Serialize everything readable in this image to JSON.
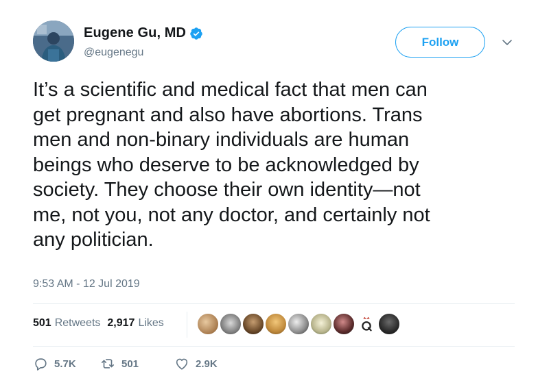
{
  "author": {
    "display_name": "Eugene Gu, MD",
    "handle": "@eugenegu",
    "verified": true,
    "avatar_icon": "profile-photo"
  },
  "follow_button": {
    "label": "Follow"
  },
  "menu": {
    "icon": "chevron-down-icon"
  },
  "tweet": {
    "lines": [
      "It’s a scientific and medical fact that men can",
      "get pregnant and also have abortions. Trans",
      "men and non-binary individuals are human",
      "beings who deserve to be acknowledged by",
      "society. They choose their own identity—not",
      "me, not you, not any doctor, and certainly not",
      "any politician."
    ],
    "timestamp": "9:53 AM - 12 Jul 2019"
  },
  "stats": {
    "retweets_count": "501",
    "retweets_label": "Retweets",
    "likes_count": "2,917",
    "likes_label": "Likes",
    "liker_count": 9
  },
  "actions": {
    "replies": "5.7K",
    "retweets": "501",
    "likes": "2.9K"
  },
  "colors": {
    "accent": "#1da1f2",
    "text": "#14171a",
    "secondary": "#657786",
    "divider": "#e6ecf0"
  }
}
